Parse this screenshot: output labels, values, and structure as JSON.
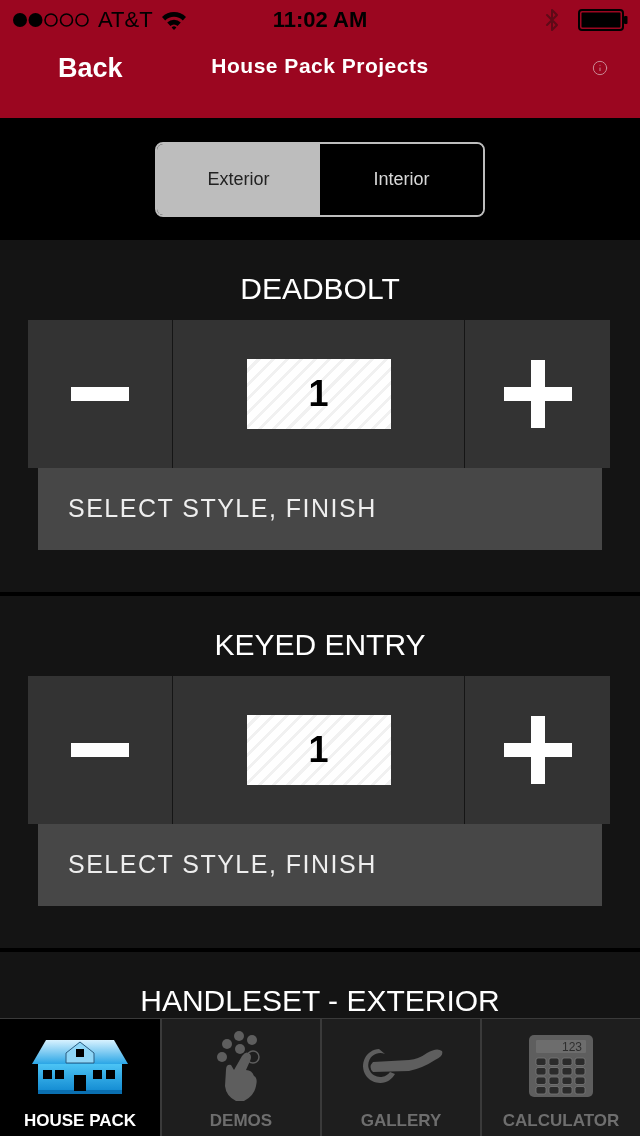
{
  "status_bar": {
    "carrier": "AT&T",
    "time": "11:02 AM"
  },
  "nav_bar": {
    "back_button": "Back",
    "title": "House Pack Projects"
  },
  "segments": [
    {
      "label": "Exterior",
      "selected": true
    },
    {
      "label": "Interior",
      "selected": false
    }
  ],
  "products": [
    {
      "title": "DEADBOLT",
      "quantity": "1",
      "select_label": "SELECT STYLE, FINISH"
    },
    {
      "title": "KEYED ENTRY",
      "quantity": "1",
      "select_label": "SELECT STYLE, FINISH"
    },
    {
      "title": "HANDLESET - EXTERIOR"
    }
  ],
  "tab_bar": [
    {
      "kind": "house",
      "label": "HOUSE PACK",
      "selected": true
    },
    {
      "kind": "demos",
      "label": "DEMOS",
      "selected": false
    },
    {
      "kind": "gallery",
      "label": "GALLERY",
      "selected": false
    },
    {
      "kind": "calculator",
      "label": "CALCULATOR",
      "selected": false,
      "icon_text": "123"
    }
  ]
}
